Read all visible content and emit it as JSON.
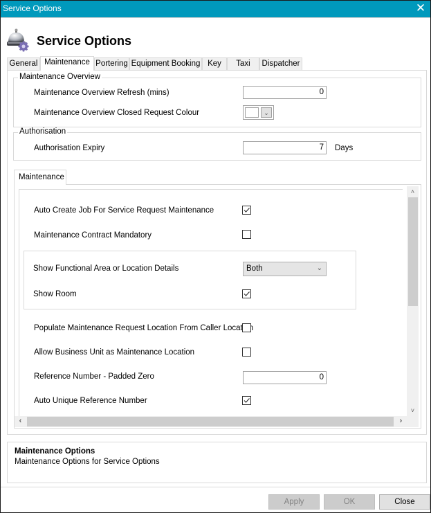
{
  "window": {
    "title": "Service Options",
    "close_glyph": "✕"
  },
  "header": {
    "icon": "service-bell-gear-icon",
    "title": "Service Options"
  },
  "tabs": [
    {
      "label": "General",
      "active": false
    },
    {
      "label": "Maintenance",
      "active": true
    },
    {
      "label": "Portering",
      "active": false
    },
    {
      "label": "Equipment Booking",
      "active": false
    },
    {
      "label": "Key",
      "active": false
    },
    {
      "label": "Taxi",
      "active": false
    },
    {
      "label": "Dispatcher",
      "active": false
    }
  ],
  "maintenance_overview": {
    "legend": "Maintenance Overview",
    "refresh_label": "Maintenance Overview Refresh (mins)",
    "refresh_value": "0",
    "colour_label": "Maintenance Overview Closed Request Colour",
    "colour_value": "#ffffff",
    "colour_arrow": "⌄"
  },
  "authorisation": {
    "legend": "Authorisation",
    "expiry_label": "Authorisation Expiry",
    "expiry_value": "7",
    "expiry_unit": "Days"
  },
  "maintenance_section": {
    "tab_label": "Maintenance",
    "options": {
      "auto_create_job": {
        "label": "Auto Create Job For Service Request Maintenance",
        "checked": true
      },
      "contract_mandatory": {
        "label": "Maintenance Contract Mandatory",
        "checked": false
      },
      "show_functional_area": {
        "label": "Show Functional Area or Location Details",
        "value": "Both",
        "arrow": "⌄"
      },
      "show_room": {
        "label": "Show Room",
        "checked": true
      },
      "populate_location": {
        "label": "Populate Maintenance Request Location From Caller Location",
        "checked": false
      },
      "allow_business_unit": {
        "label": "Allow Business Unit as Maintenance Location",
        "checked": false
      },
      "ref_padded_zero": {
        "label": "Reference Number - Padded Zero",
        "value": "0"
      },
      "auto_unique_ref": {
        "label": "Auto Unique Reference Number",
        "checked": true
      }
    },
    "scroll": {
      "up": "˄",
      "down": "˅",
      "left": "‹",
      "right": "›"
    }
  },
  "description": {
    "title": "Maintenance Options",
    "text": "Maintenance Options for Service Options"
  },
  "footer": {
    "apply_label": "Apply",
    "ok_label": "OK",
    "close_label": "Close"
  }
}
